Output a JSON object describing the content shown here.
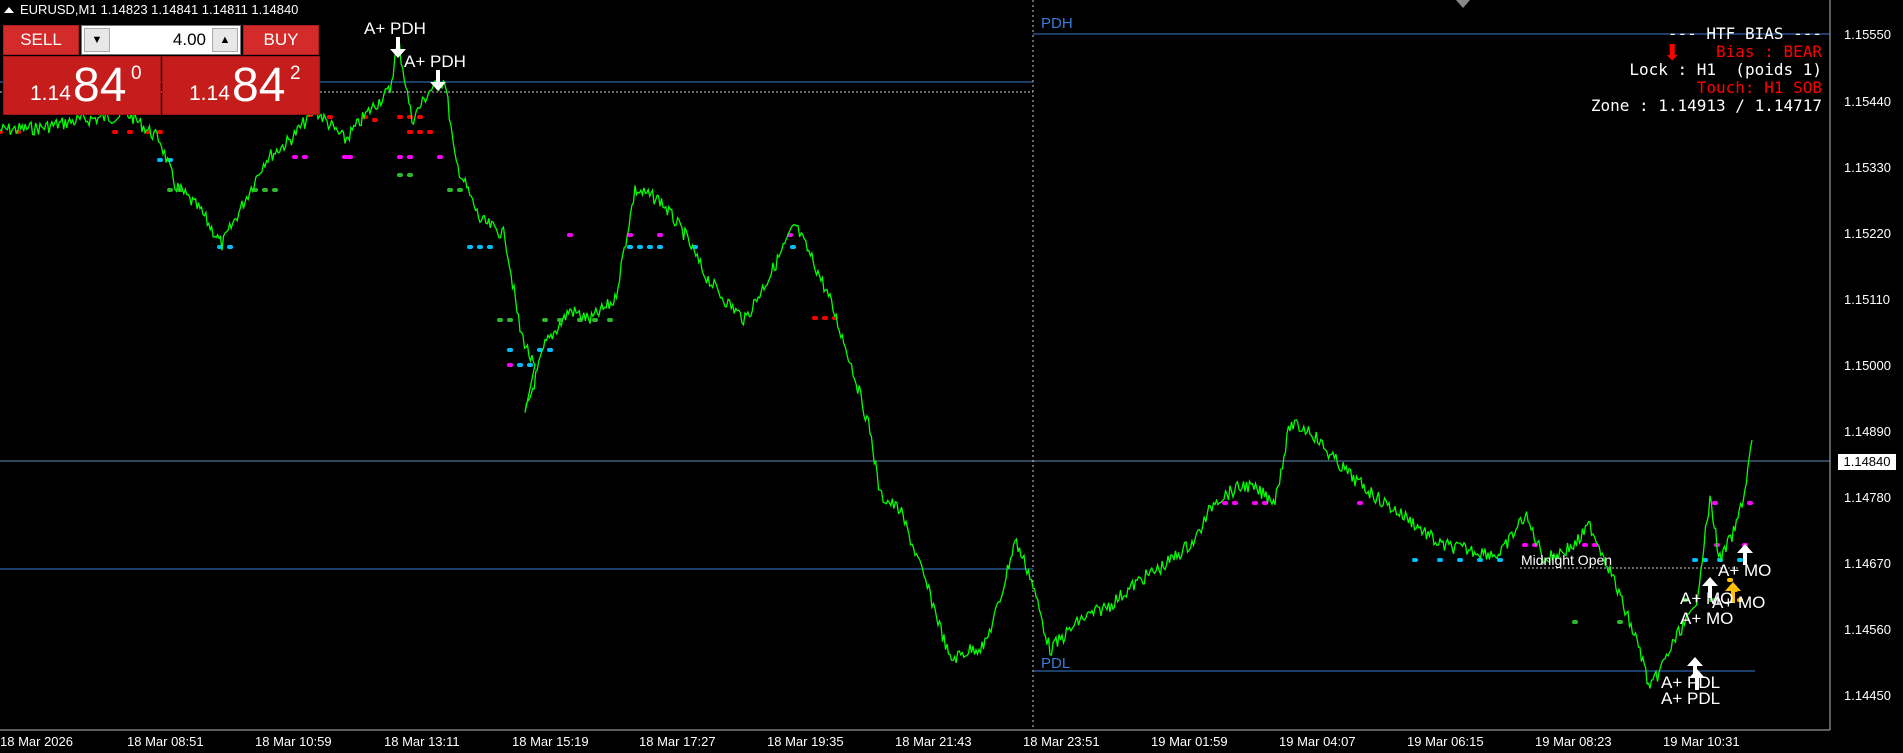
{
  "header": {
    "symbol": "EURUSD,M1",
    "ohlc": "1.14823 1.14841 1.14811 1.14840"
  },
  "trade_panel": {
    "sell_label": "SELL",
    "buy_label": "BUY",
    "volume": "4.00",
    "bid_prefix": "1.14",
    "bid_big": "84",
    "bid_sup": "0",
    "ask_prefix": "1.14",
    "ask_big": "84",
    "ask_sup": "2"
  },
  "price_axis": {
    "ticks": [
      "1.15550",
      "1.15440",
      "1.15330",
      "1.15220",
      "1.15110",
      "1.15000",
      "1.14890",
      "1.14780",
      "1.14670",
      "1.14560",
      "1.14450"
    ],
    "current_price": "1.14840"
  },
  "time_axis": {
    "ticks": [
      "18 Mar 2026",
      "18 Mar 08:51",
      "18 Mar 10:59",
      "18 Mar 13:11",
      "18 Mar 15:19",
      "18 Mar 17:27",
      "18 Mar 19:35",
      "18 Mar 21:43",
      "18 Mar 23:51",
      "19 Mar 01:59",
      "19 Mar 04:07",
      "19 Mar 06:15",
      "19 Mar 08:23",
      "19 Mar 10:31"
    ]
  },
  "levels": {
    "pdh_label": "PDH",
    "pdl_label": "PDL",
    "midnight_label": "Midnight Open"
  },
  "signals": {
    "apdh": "A+ PDH",
    "apdh_overlap": "A+ PDH",
    "apdl_1": "A+ PDL",
    "apdl_2": "A+ PDL",
    "amo_1": "A+ MO",
    "amo_2": "A+ MO",
    "amo_3": "A+ MO",
    "amo_4": "A+ MO"
  },
  "htf_bias": {
    "title": "--- HTF BIAS ---",
    "bias": "Bias : BEAR",
    "lock": "Lock : H1  (poids 1)",
    "touch": "Touch: H1 SOB",
    "zone": "Zone : 1.14913 / 1.14717"
  },
  "colors": {
    "background": "#000000",
    "candles": "#00ff00",
    "levels": "#3a7bd5",
    "sell_red": "#d32a2a",
    "bear_red": "#ff0000",
    "magenta": "#ff00ff",
    "cyan": "#00bfff",
    "green_dots": "#2eb82e",
    "gold": "#ffc000"
  }
}
